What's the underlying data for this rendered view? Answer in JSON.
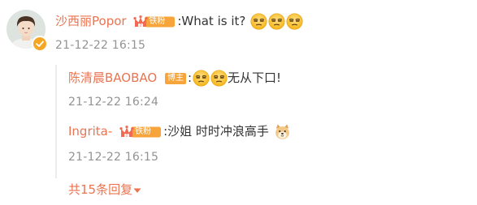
{
  "main_comment": {
    "username": "沙西丽Popor",
    "fan_badge": "铁粉",
    "text": ":What is it?",
    "time": "21-12-22 16:15"
  },
  "replies": [
    {
      "username": "陈清晨BAOBAO",
      "badge": "博主",
      "text": "无从下口!",
      "time": "21-12-22 16:24"
    },
    {
      "username": "Ingrita-",
      "fan_badge": "铁粉",
      "text": ":沙姐 时时冲浪高手",
      "time": "21-12-22 16:15"
    }
  ],
  "more_replies_label": "共15条回复",
  "colors": {
    "name": "#eb7350",
    "text": "#333333",
    "time": "#939393",
    "verified": "#f5a623"
  }
}
